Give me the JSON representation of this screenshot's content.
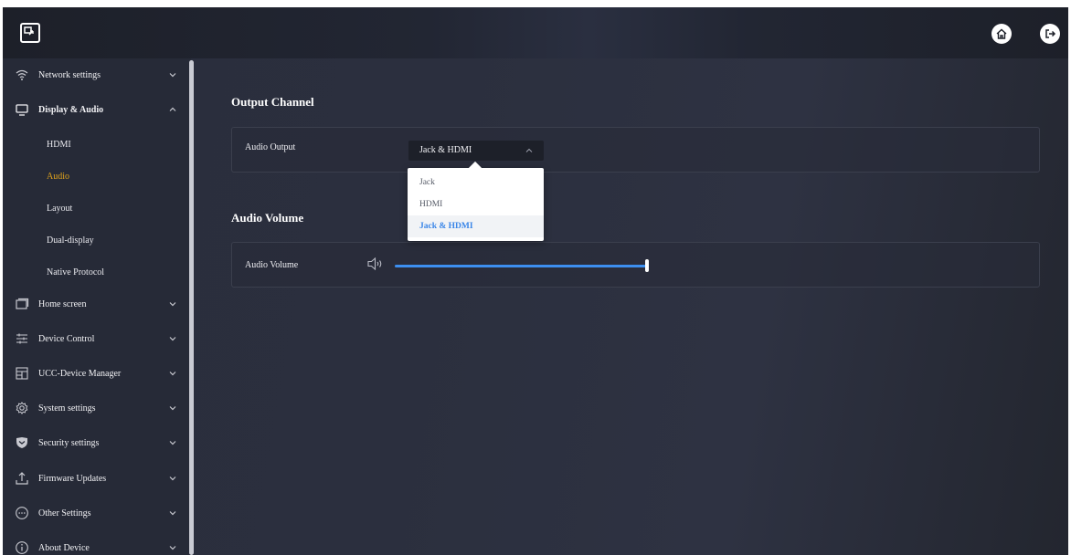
{
  "sidebar": {
    "items": [
      {
        "label": "Network settings",
        "icon": "wifi-icon"
      },
      {
        "label": "Display & Audio",
        "icon": "monitor-icon"
      },
      {
        "label": "Home screen",
        "icon": "home-screen-icon"
      },
      {
        "label": "Device Control",
        "icon": "sliders-icon"
      },
      {
        "label": "UCC-Device Manager",
        "icon": "device-manager-icon"
      },
      {
        "label": "System settings",
        "icon": "gear-icon"
      },
      {
        "label": "Security settings",
        "icon": "shield-icon"
      },
      {
        "label": "Firmware Updates",
        "icon": "upload-icon"
      },
      {
        "label": "Other Settings",
        "icon": "ellipsis-icon"
      },
      {
        "label": "About Device",
        "icon": "info-icon"
      }
    ],
    "display_audio_sub": [
      "HDMI",
      "Audio",
      "Layout",
      "Dual-display",
      "Native Protocol"
    ]
  },
  "output": {
    "title": "Output Channel",
    "label": "Audio Output",
    "selected": "Jack & HDMI",
    "options": [
      "Jack",
      "HDMI",
      "Jack & HDMI"
    ]
  },
  "volume": {
    "title": "Audio Volume",
    "label": "Audio Volume",
    "level": 1.0
  },
  "colors": {
    "accent": "#3d8ff0",
    "selected_nav": "#e0a31c"
  }
}
